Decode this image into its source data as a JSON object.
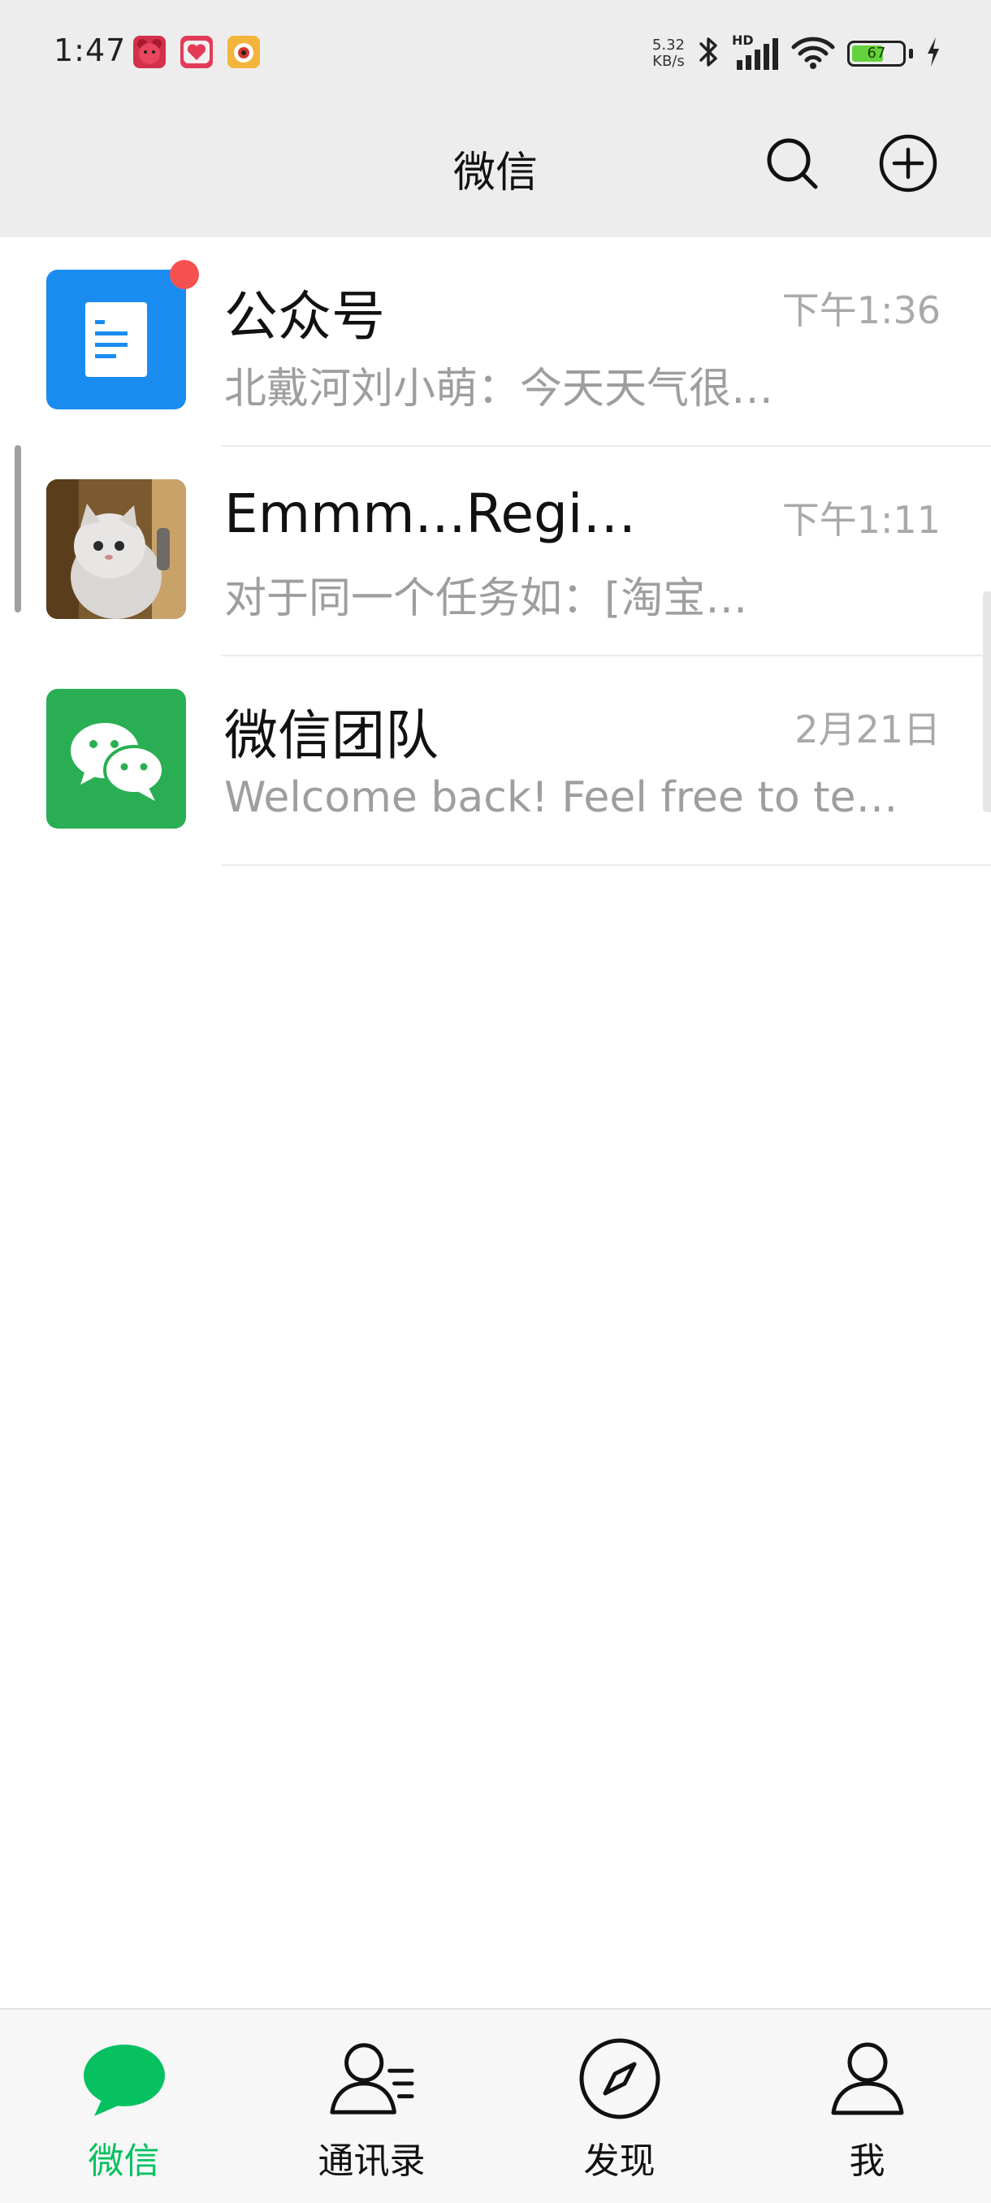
{
  "status_bar": {
    "time": "1:47",
    "net_speed_value": "5.32",
    "net_speed_unit": "KB/s",
    "network_label": "HD",
    "battery_level": "67",
    "app_icons": [
      "bear-app-icon",
      "heart-app-icon",
      "camera-app-icon"
    ]
  },
  "header": {
    "title": "微信",
    "search_icon": "search-icon",
    "add_icon": "plus-circle-icon"
  },
  "chats": [
    {
      "name": "公众号",
      "time": "下午1:36",
      "preview": "北戴河刘小萌：今天天气很…",
      "avatar": "official-accounts-icon",
      "unread_dot": true,
      "color": "#1a8cf0"
    },
    {
      "name": "Emmm...Regi…",
      "time": "下午1:11",
      "preview": "对于同一个任务如：[淘宝…",
      "avatar": "cat-photo-avatar",
      "unread_dot": false
    },
    {
      "name": "微信团队",
      "time": "2月21日",
      "preview": "Welcome back! Feel free to te…",
      "avatar": "wechat-logo-icon",
      "unread_dot": false,
      "color": "#2aae53"
    }
  ],
  "tabs": [
    {
      "label": "微信",
      "icon": "chat-bubble-icon",
      "active": true
    },
    {
      "label": "通讯录",
      "icon": "contacts-icon",
      "active": false
    },
    {
      "label": "发现",
      "icon": "compass-icon",
      "active": false
    },
    {
      "label": "我",
      "icon": "person-icon",
      "active": false
    }
  ],
  "colors": {
    "accent": "#07c160",
    "header_bg": "#ededed",
    "unread": "#f5524f",
    "secondary_text": "#9e9e9e"
  }
}
